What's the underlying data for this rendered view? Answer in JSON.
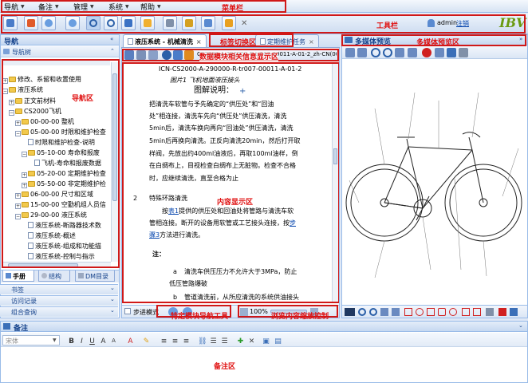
{
  "menubar": {
    "items": [
      "导航",
      "备注",
      "管理",
      "系统",
      "帮助"
    ],
    "annotation": "菜单栏"
  },
  "toolbar": {
    "user_label": "admin",
    "logout_label": "注销",
    "logo_text": "IBV",
    "annotation": "工具栏"
  },
  "nav": {
    "title": "导航",
    "tree_title": "导航树",
    "annotation": "导航区",
    "tree": [
      "修改、系留和收置使用",
      "液压系统",
      "正文前材料",
      "CS2000飞机",
      "00-00-00 整机",
      "05-00-00 时限和维护检查",
      "时限和维护检查-说明",
      "05-10-00 寿命和报废",
      "飞机-寿命和报废数据",
      "05-20-00 定期维护检查",
      "05-50-00 非定期维护检",
      "06-00-00 尺寸和区域",
      "15-00-00 空勤机组人员信",
      "29-00-00 液压系统",
      "液压系统-断路器技术数",
      "液压系统-概述",
      "液压系统-组成和功能描",
      "液压系统-控制与指示"
    ],
    "tabs": [
      "手册",
      "结构",
      "DM目录"
    ],
    "accordions": [
      "书签",
      "访问记录",
      "组合查询"
    ]
  },
  "content": {
    "tabs": [
      "液压系统 - 机械清洗",
      "定期维护任务"
    ],
    "tab_annotation": "标签切换区",
    "module_id": "CS2000-A-290000-R-tr007-00011-A-01-2_zh-CN(000_02)",
    "info_annotation": "数据模块相关信息显示区",
    "doc_code": "ICN-CS2000-A-290000-R-tr007-00011-A-01-2",
    "figure_caption": "图片1   飞机地面液压接头",
    "legend_title": "图解说明：",
    "para1": [
      "把清洗车软管与予先确定的“供压处”和“回油",
      "处”相连接，清洗车先向“供压处”供压清洗，清洗",
      "5min后，清洗车换向再向“回油处”供压清洗，清洗",
      "5min后再换向清洗。正反向清洗20min，然后打开取",
      "样阀，先放出约400ml油液后，再取100ml油样，倒",
      "在白绸布上，目视检查白绸布上无脏物。检查不合格",
      "时，应继续清洗，直至合格为止"
    ],
    "step_num": "2",
    "step_title": "特殊环路清洗",
    "content_annotation": "内容显示区",
    "para2_a": "按",
    "para2_link1": "表1",
    "para2_b": "提供的供压处和回油处将管路与清洗车软",
    "para2_c": "管相连接。断开的设备用软管或工艺接头连接，按",
    "para2_link2": "步",
    "para2_d": "骤3",
    "para2_e": "方法进行清洗。",
    "note_label": "注：",
    "note_a_mark": "a",
    "note_a_1": "清洗车供压压力不允许大于3MPa，防止",
    "note_a_2": "低压管路爆破",
    "note_b_mark": "b",
    "note_b_1": "管道清洗前，从所应清洗的系统供油接头",
    "step_mode_label": "步进模式",
    "nav_annotation": "特定模块导航工具",
    "zoom_value": "100%",
    "zoom_annotation": "浏览内容缩放控制"
  },
  "preview": {
    "title": "多媒体预览",
    "annotation": "多媒体预览区"
  },
  "notes": {
    "title": "备注",
    "font_value": "宋体",
    "annotation": "备注区"
  },
  "colors": {
    "red": "#d01818",
    "header": "#c5d8f1",
    "accent": "#15428b"
  }
}
